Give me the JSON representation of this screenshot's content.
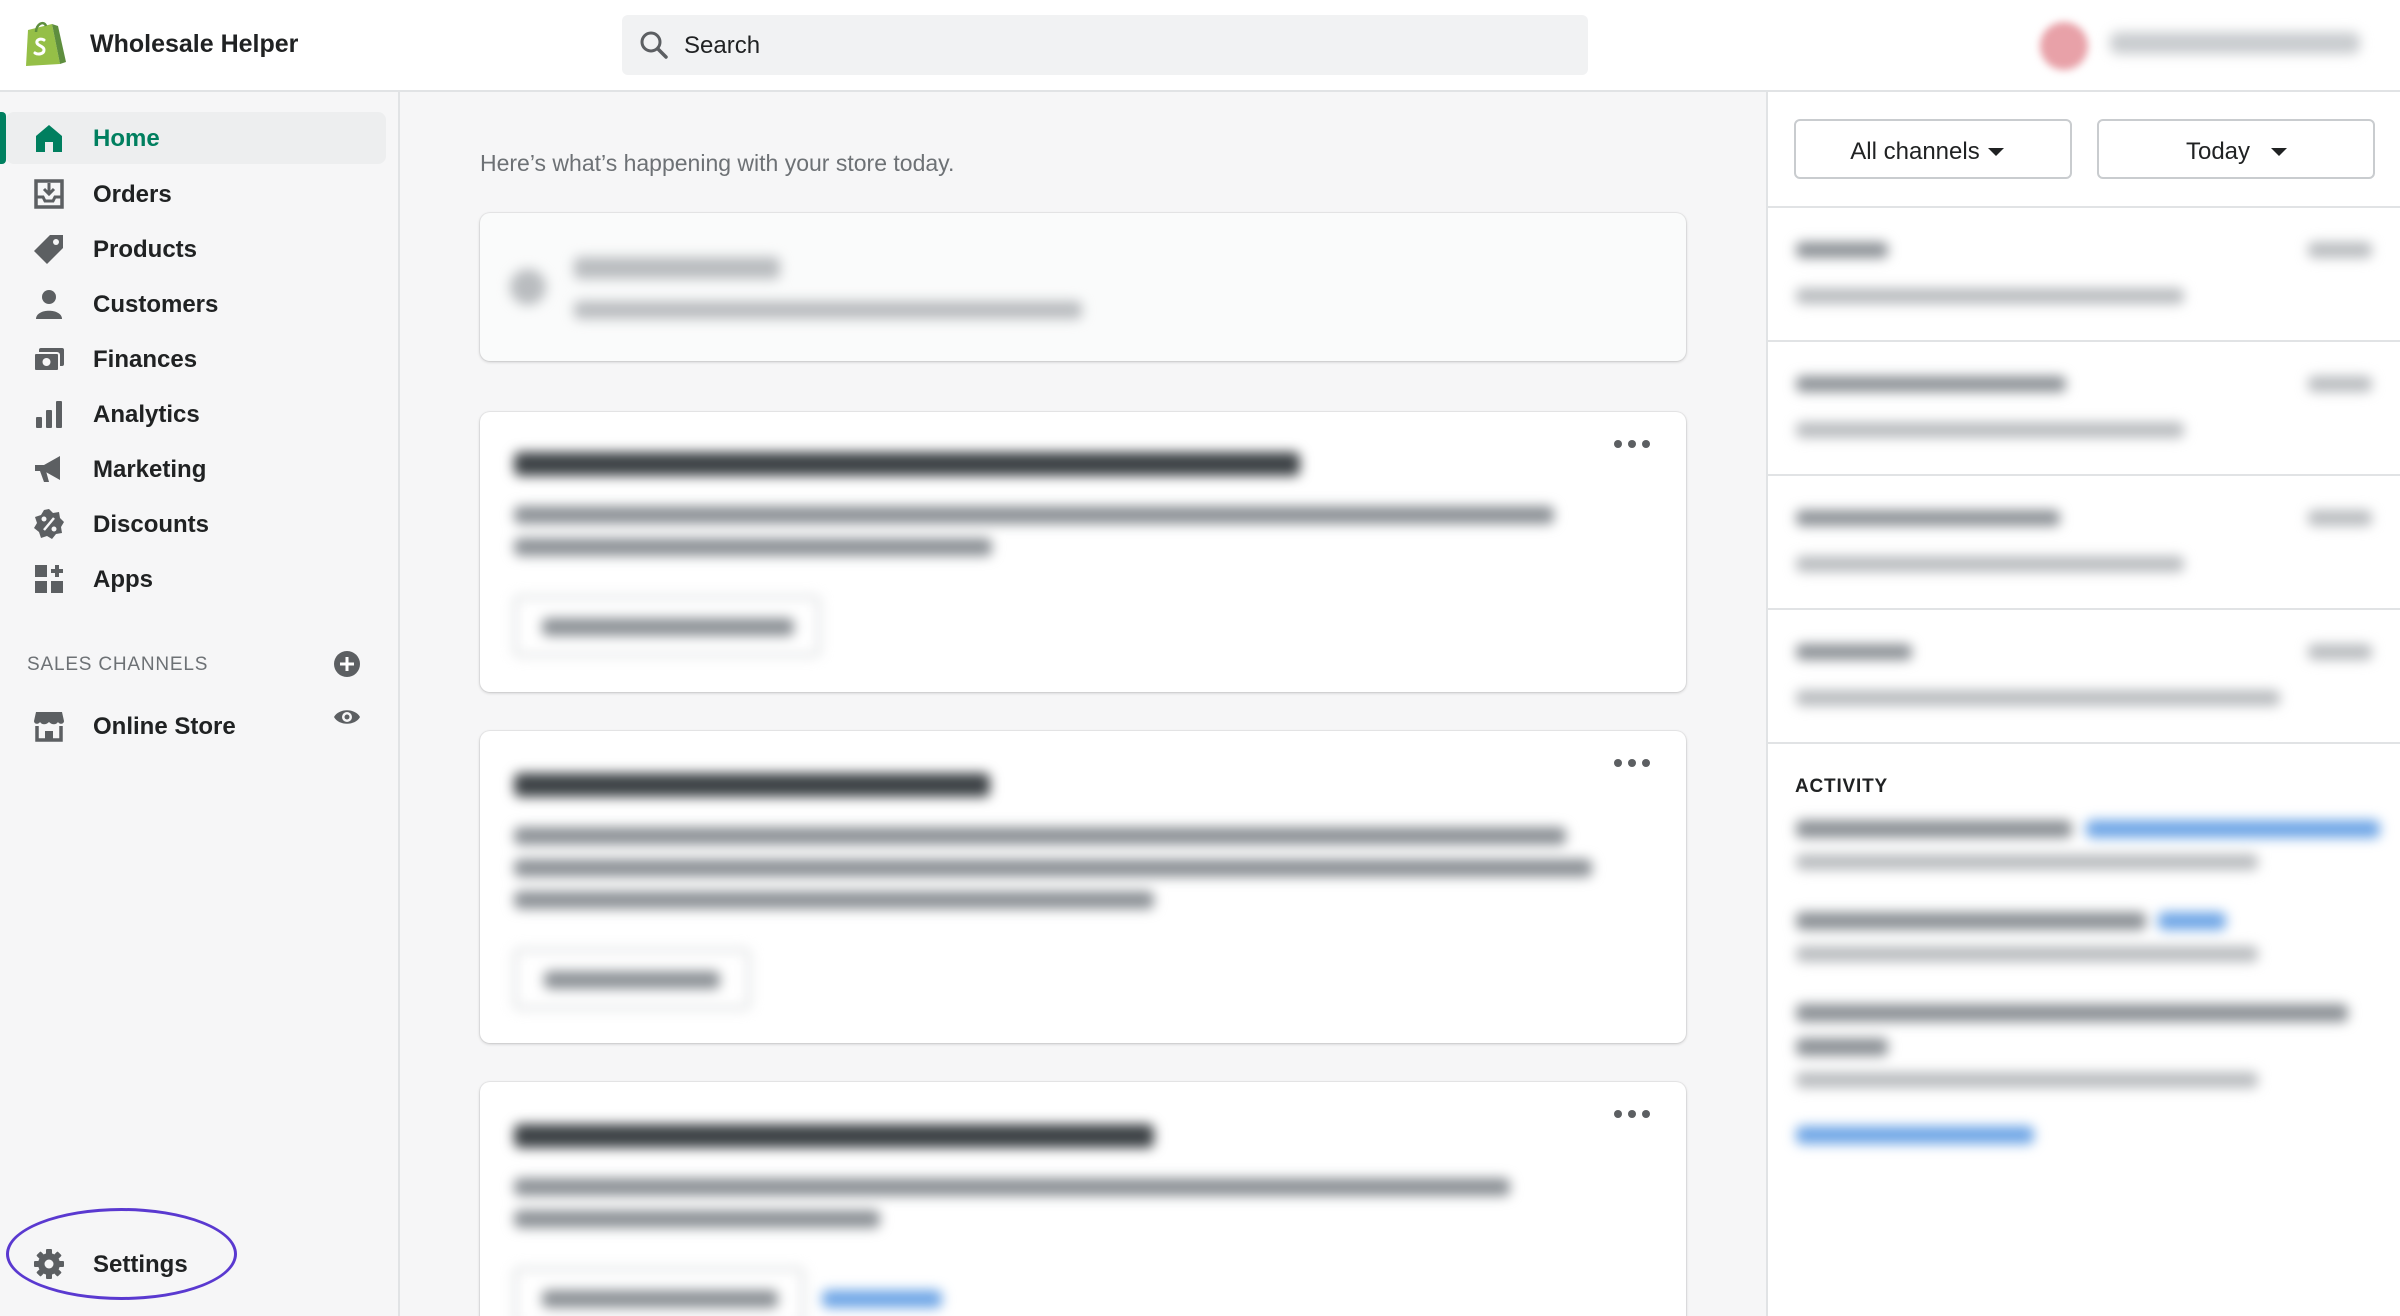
{
  "header": {
    "store_name": "Wholesale Helper",
    "search_placeholder": "Search"
  },
  "sidebar": {
    "items": [
      {
        "label": "Home",
        "icon": "home-icon",
        "active": true
      },
      {
        "label": "Orders",
        "icon": "orders-icon"
      },
      {
        "label": "Products",
        "icon": "tag-icon"
      },
      {
        "label": "Customers",
        "icon": "person-icon"
      },
      {
        "label": "Finances",
        "icon": "finances-icon"
      },
      {
        "label": "Analytics",
        "icon": "bar-chart-icon"
      },
      {
        "label": "Marketing",
        "icon": "megaphone-icon"
      },
      {
        "label": "Discounts",
        "icon": "discount-icon"
      },
      {
        "label": "Apps",
        "icon": "apps-icon"
      }
    ],
    "sales_channels_title": "SALES CHANNELS",
    "online_store_label": "Online Store",
    "settings_label": "Settings"
  },
  "main": {
    "intro": "Here’s what’s happening with your store today."
  },
  "right_panel": {
    "channels_label": "All channels",
    "date_label": "Today",
    "activity_title": "ACTIVITY"
  },
  "colors": {
    "accent": "#008060",
    "annotation_ring": "#5a39d0"
  }
}
